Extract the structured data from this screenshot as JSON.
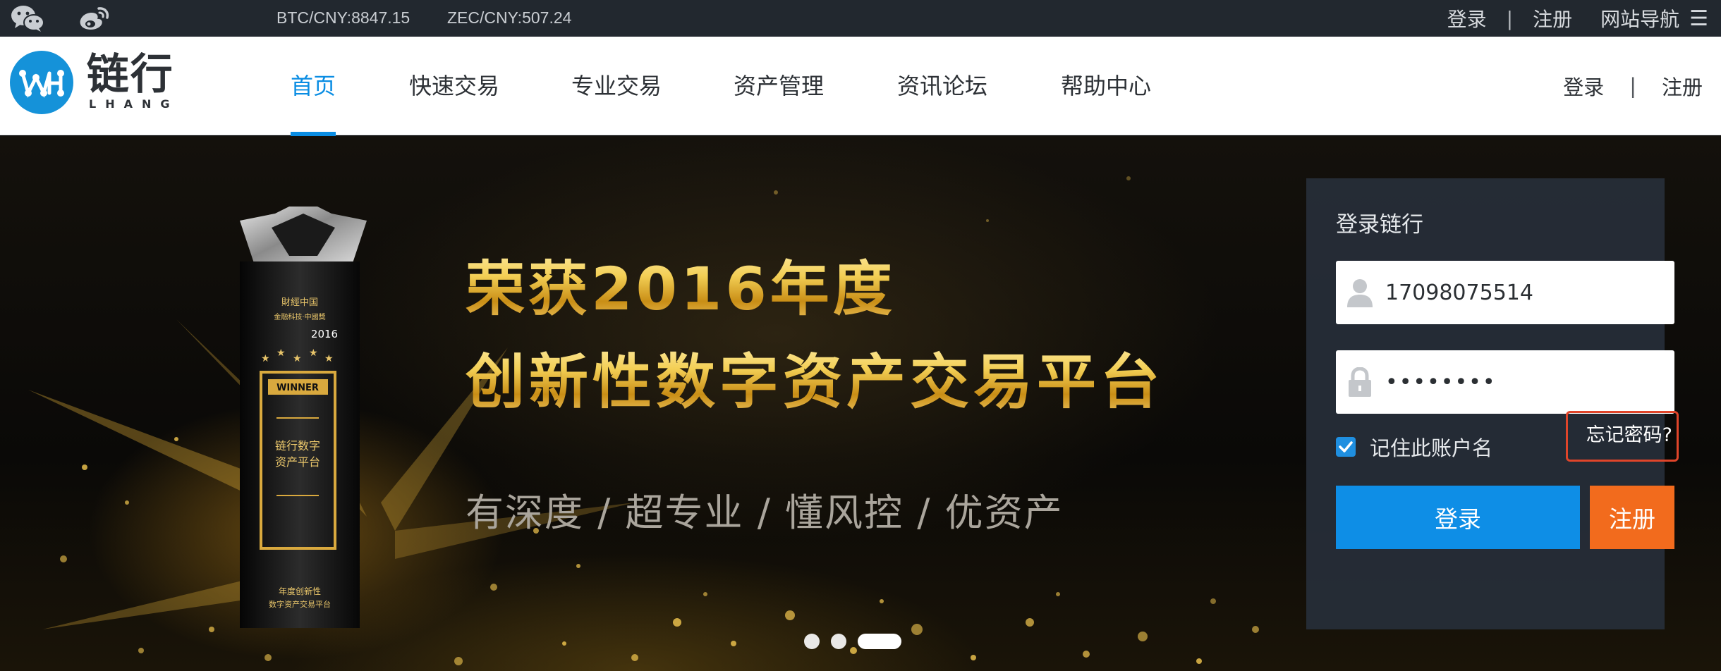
{
  "topbar": {
    "icons": [
      "wechat-icon",
      "weibo-icon"
    ],
    "tickers": [
      "BTC/CNY:8847.15",
      "ZEC/CNY:507.24"
    ],
    "login_label": "登录",
    "separator": "|",
    "register_label": "注册",
    "site_nav_label": "网站导航",
    "menu_glyph": "☰"
  },
  "header": {
    "logo": {
      "cn": "链行",
      "en": "LHANG"
    },
    "nav": [
      {
        "label": "首页",
        "active": true
      },
      {
        "label": "快速交易",
        "active": false
      },
      {
        "label": "专业交易",
        "active": false
      },
      {
        "label": "资产管理",
        "active": false
      },
      {
        "label": "资讯论坛",
        "active": false
      },
      {
        "label": "帮助中心",
        "active": false
      }
    ],
    "login_label": "登录",
    "separator": "|",
    "register_label": "注册"
  },
  "banner": {
    "headline_1": "荣获2016年度",
    "headline_2": "创新性数字资产交易平台",
    "tagline": "有深度 / 超专业 / 懂风控 / 优资产",
    "trophy": {
      "brand": "財經中国",
      "sub": "金融科技·中國獎",
      "year": "2016",
      "plate": "WINNER",
      "inscription": [
        "链行数字",
        "资产平台"
      ],
      "base": [
        "年度创新性",
        "数字资产交易平台"
      ]
    },
    "slides": 3,
    "active_slide": 3
  },
  "login": {
    "title": "登录链行",
    "username_value": "17098075514",
    "password_value": "password",
    "remember_label": "记住此账户名",
    "remember_checked": true,
    "forgot_label": "忘记密码?",
    "login_button": "登录",
    "register_button": "注册"
  },
  "colors": {
    "topbar_bg": "#22282f",
    "brand_blue": "#1592d9",
    "active_blue": "#0a8de3",
    "login_button": "#0e8ee6",
    "register_button": "#f26b1d",
    "highlight_red": "#e0452a"
  }
}
